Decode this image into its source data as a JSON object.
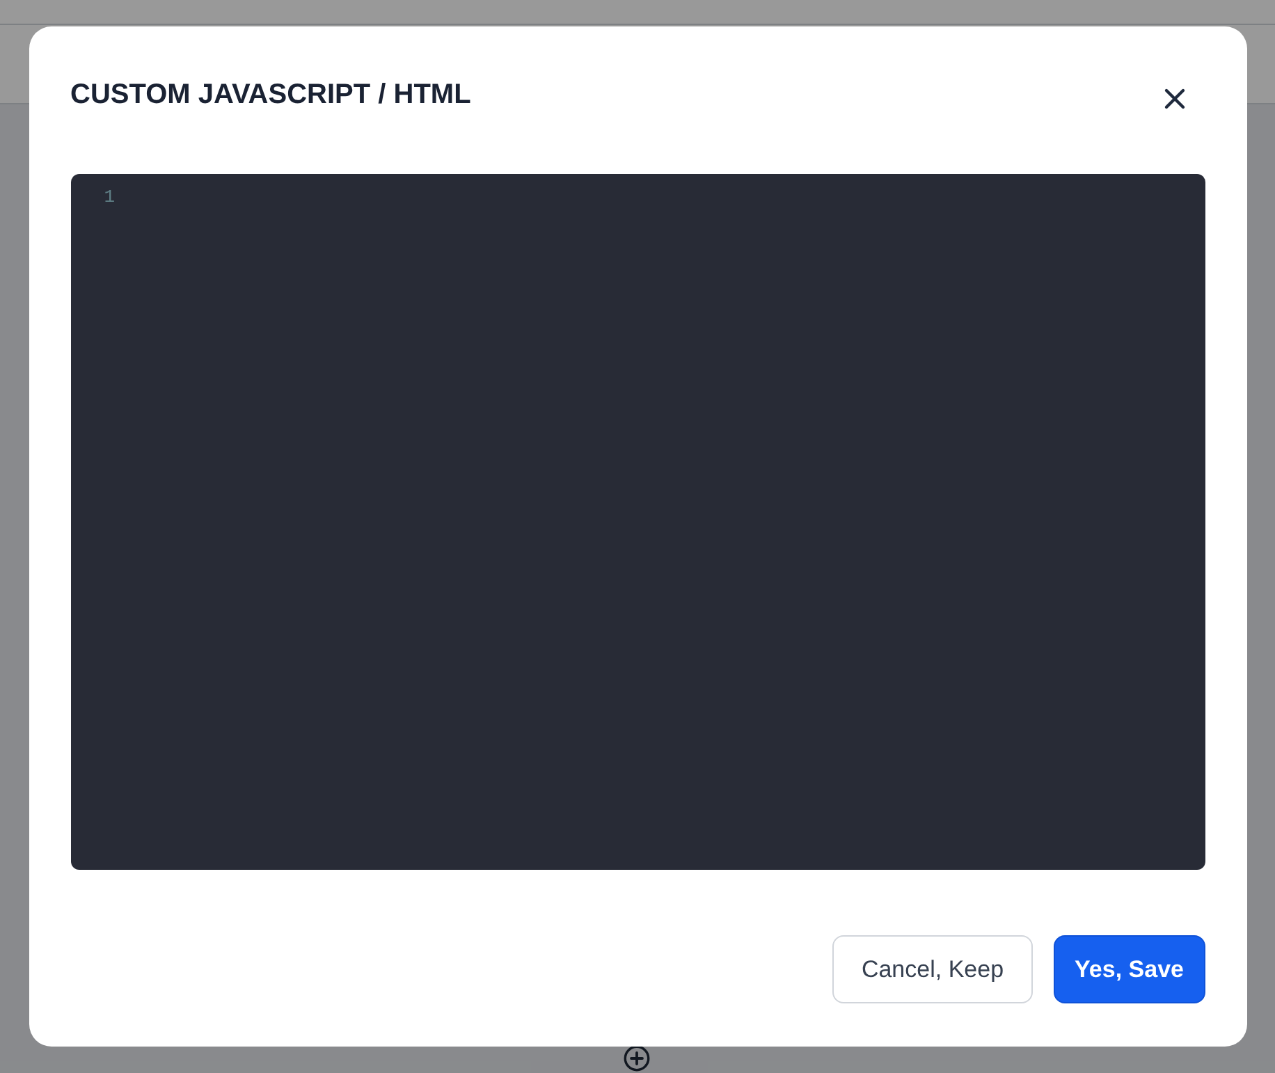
{
  "dialog": {
    "title": "CUSTOM JAVASCRIPT / HTML",
    "editor": {
      "line_numbers": [
        "1"
      ]
    },
    "buttons": [
      {
        "label": "Cancel, Keep",
        "kind": "secondary"
      },
      {
        "label": "Yes, Save",
        "kind": "primary"
      }
    ]
  }
}
